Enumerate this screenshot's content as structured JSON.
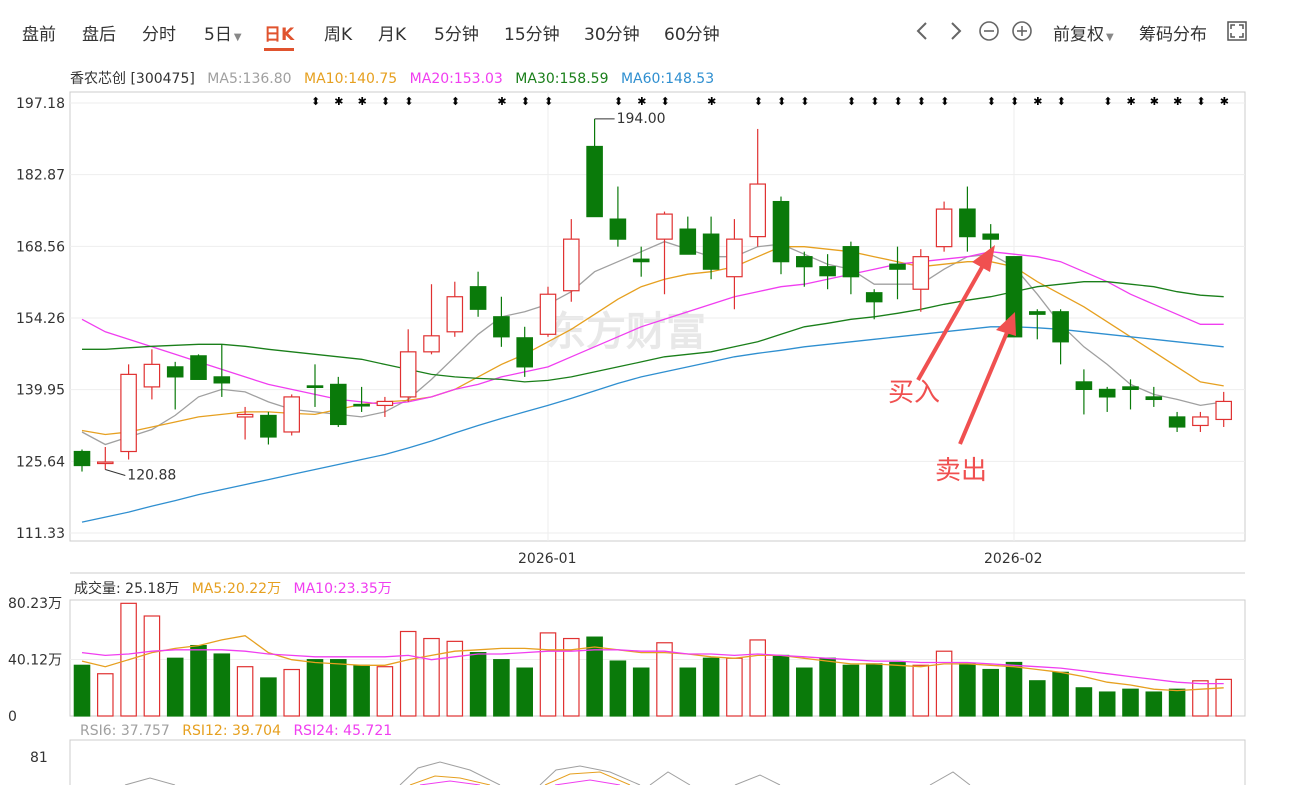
{
  "toolbar": {
    "tabs": [
      "盘前",
      "盘后",
      "分时",
      "5日",
      "日K",
      "周K",
      "月K",
      "5分钟",
      "15分钟",
      "30分钟",
      "60分钟"
    ],
    "active_tab": "日K",
    "prev_icon": "chevron-left-icon",
    "next_icon": "chevron-right-icon",
    "zoom_out_icon": "zoom-out-icon",
    "zoom_in_icon": "zoom-in-icon",
    "adjust_label": "前复权",
    "chip_label": "筹码分布",
    "fullscreen_icon": "fullscreen-icon"
  },
  "price_legend": {
    "stock": "香农芯创 [300475]",
    "ma5": "MA5:136.80",
    "ma10": "MA10:140.75",
    "ma20": "MA20:153.03",
    "ma30": "MA30:158.59",
    "ma60": "MA60:148.53"
  },
  "volume_legend": {
    "vol": "成交量: 25.18万",
    "ma5": "MA5:20.22万",
    "ma10": "MA10:23.35万"
  },
  "rsi_legend": {
    "rsi6": "RSI6: 37.757",
    "rsi12": "RSI12: 39.704",
    "rsi24": "RSI24: 45.721"
  },
  "colors": {
    "up": "#e03131",
    "down": "#0a7a0a",
    "ma5": "#a0a0a0",
    "ma10": "#e6a020",
    "ma20": "#f03ef0",
    "ma30": "#1a7f1a",
    "ma60": "#2f8fd0",
    "arrow": "#f05050"
  },
  "watermark": "东方财富",
  "chart_data": {
    "type": "candlestick",
    "price_axis": {
      "ticks": [
        "197.18",
        "182.87",
        "168.56",
        "154.26",
        "139.95",
        "125.64",
        "111.33"
      ],
      "ylim": [
        111.33,
        197.18
      ]
    },
    "x_ticks": [
      {
        "index": 20,
        "label": "2026-01"
      },
      {
        "index": 40,
        "label": "2026-02"
      }
    ],
    "candles": [
      {
        "o": 127.6,
        "h": 128.0,
        "l": 123.6,
        "c": 124.8
      },
      {
        "o": 125.5,
        "h": 128.5,
        "l": 124.0,
        "c": 125.5
      },
      {
        "o": 127.6,
        "h": 145.0,
        "l": 126.0,
        "c": 143.0
      },
      {
        "o": 140.5,
        "h": 148.0,
        "l": 138.0,
        "c": 145.0
      },
      {
        "o": 144.5,
        "h": 145.5,
        "l": 136.0,
        "c": 142.5
      },
      {
        "o": 146.7,
        "h": 147.0,
        "l": 142.0,
        "c": 142.0
      },
      {
        "o": 142.5,
        "h": 149.0,
        "l": 138.5,
        "c": 141.3
      },
      {
        "o": 134.5,
        "h": 136.5,
        "l": 130.0,
        "c": 135.0
      },
      {
        "o": 134.8,
        "h": 135.5,
        "l": 129.0,
        "c": 130.5
      },
      {
        "o": 131.5,
        "h": 139.0,
        "l": 130.8,
        "c": 138.5
      },
      {
        "o": 140.7,
        "h": 145.0,
        "l": 136.5,
        "c": 140.5
      },
      {
        "o": 141.0,
        "h": 142.5,
        "l": 132.5,
        "c": 133.0
      },
      {
        "o": 137.0,
        "h": 140.5,
        "l": 135.5,
        "c": 136.8
      },
      {
        "o": 136.8,
        "h": 138.5,
        "l": 134.5,
        "c": 137.6
      },
      {
        "o": 138.5,
        "h": 152.0,
        "l": 137.5,
        "c": 147.5
      },
      {
        "o": 147.5,
        "h": 161.0,
        "l": 147.0,
        "c": 150.7
      },
      {
        "o": 151.5,
        "h": 161.5,
        "l": 150.5,
        "c": 158.5
      },
      {
        "o": 160.5,
        "h": 163.5,
        "l": 154.5,
        "c": 156.0
      },
      {
        "o": 154.5,
        "h": 158.5,
        "l": 148.5,
        "c": 150.5
      },
      {
        "o": 150.3,
        "h": 152.5,
        "l": 142.5,
        "c": 144.5
      },
      {
        "o": 151.0,
        "h": 160.5,
        "l": 150.5,
        "c": 159.0
      },
      {
        "o": 159.7,
        "h": 174.0,
        "l": 157.5,
        "c": 170.0
      },
      {
        "o": 188.5,
        "h": 194.0,
        "l": 174.5,
        "c": 174.5
      },
      {
        "o": 174.0,
        "h": 180.5,
        "l": 168.5,
        "c": 170.0
      },
      {
        "o": 166.0,
        "h": 168.5,
        "l": 162.5,
        "c": 165.5
      },
      {
        "o": 170.0,
        "h": 175.5,
        "l": 159.0,
        "c": 175.0
      },
      {
        "o": 172.0,
        "h": 174.5,
        "l": 167.0,
        "c": 167.0
      },
      {
        "o": 171.0,
        "h": 174.5,
        "l": 162.0,
        "c": 164.0
      },
      {
        "o": 162.5,
        "h": 174.0,
        "l": 156.0,
        "c": 170.0
      },
      {
        "o": 170.5,
        "h": 192.0,
        "l": 168.5,
        "c": 181.0
      },
      {
        "o": 177.5,
        "h": 178.5,
        "l": 163.0,
        "c": 165.5
      },
      {
        "o": 166.5,
        "h": 167.5,
        "l": 160.5,
        "c": 164.5
      },
      {
        "o": 164.5,
        "h": 167.0,
        "l": 160.0,
        "c": 162.7
      },
      {
        "o": 168.5,
        "h": 169.5,
        "l": 159.0,
        "c": 162.5
      },
      {
        "o": 159.3,
        "h": 160.0,
        "l": 154.0,
        "c": 157.5
      },
      {
        "o": 165.0,
        "h": 168.5,
        "l": 158.0,
        "c": 164.0
      },
      {
        "o": 160.0,
        "h": 168.0,
        "l": 155.5,
        "c": 166.5
      },
      {
        "o": 168.5,
        "h": 177.5,
        "l": 167.5,
        "c": 176.0
      },
      {
        "o": 176.0,
        "h": 180.5,
        "l": 167.5,
        "c": 170.5
      },
      {
        "o": 171.0,
        "h": 173.0,
        "l": 165.0,
        "c": 170.0
      },
      {
        "o": 166.5,
        "h": 166.5,
        "l": 150.5,
        "c": 150.5
      },
      {
        "o": 155.5,
        "h": 156.0,
        "l": 150.0,
        "c": 155.0
      },
      {
        "o": 155.5,
        "h": 156.0,
        "l": 145.0,
        "c": 149.5
      },
      {
        "o": 141.5,
        "h": 144.0,
        "l": 135.0,
        "c": 140.0
      },
      {
        "o": 140.0,
        "h": 140.5,
        "l": 135.5,
        "c": 138.5
      },
      {
        "o": 140.5,
        "h": 142.0,
        "l": 136.0,
        "c": 140.0
      },
      {
        "o": 138.5,
        "h": 140.5,
        "l": 136.5,
        "c": 138.0
      },
      {
        "o": 134.5,
        "h": 135.5,
        "l": 131.5,
        "c": 132.5
      },
      {
        "o": 132.8,
        "h": 135.5,
        "l": 131.5,
        "c": 134.5
      },
      {
        "o": 134.0,
        "h": 139.5,
        "l": 132.5,
        "c": 137.6
      }
    ],
    "volume_axis": {
      "ticks": [
        "80.23万",
        "40.12万",
        "0"
      ],
      "ylim": [
        0,
        80.23
      ]
    },
    "volume": [
      36,
      30,
      80,
      71,
      41,
      50,
      44,
      35,
      27,
      33,
      40,
      40,
      36,
      35,
      60,
      55,
      53,
      45,
      40,
      34,
      59,
      55,
      56,
      39,
      34,
      52,
      34,
      41,
      41,
      54,
      43,
      34,
      41,
      36,
      37,
      38,
      36,
      46,
      37,
      33,
      38,
      25,
      31,
      20,
      17,
      19,
      17,
      19,
      25,
      26
    ],
    "series": [
      {
        "name": "MA5",
        "values": [
          131.5,
          129.0,
          130.5,
          132.0,
          134.8,
          138.5,
          140.0,
          139.5,
          137.5,
          136.0,
          135.5,
          135.0,
          134.5,
          135.5,
          138.0,
          142.0,
          146.5,
          151.0,
          154.5,
          155.5,
          157.0,
          159.5,
          163.5,
          165.5,
          167.5,
          169.5,
          168.0,
          166.5,
          166.5,
          168.5,
          169.0,
          167.0,
          165.0,
          164.0,
          161.0,
          161.0,
          161.0,
          164.0,
          166.5,
          167.0,
          164.5,
          159.0,
          153.0,
          148.5,
          145.0,
          141.0,
          139.0,
          138.0,
          136.8,
          137.5
        ]
      },
      {
        "name": "MA10",
        "values": [
          131.8,
          131.0,
          131.5,
          132.5,
          133.5,
          134.5,
          135.0,
          135.5,
          135.5,
          135.2,
          135.0,
          136.0,
          137.0,
          137.5,
          137.8,
          138.5,
          140.0,
          142.5,
          145.0,
          147.0,
          149.5,
          152.0,
          155.0,
          158.0,
          160.5,
          162.0,
          163.0,
          163.5,
          164.5,
          166.5,
          168.5,
          168.5,
          168.0,
          167.5,
          166.5,
          165.5,
          164.5,
          165.0,
          165.5,
          165.5,
          164.5,
          161.5,
          159.0,
          156.5,
          153.5,
          150.5,
          147.5,
          144.5,
          141.5,
          140.7
        ]
      },
      {
        "name": "MA20",
        "values": [
          154.0,
          151.5,
          150.0,
          148.5,
          147.0,
          145.5,
          144.0,
          142.5,
          141.0,
          140.0,
          139.0,
          138.0,
          137.5,
          137.0,
          137.5,
          138.5,
          140.0,
          141.0,
          142.5,
          143.5,
          144.5,
          146.5,
          148.5,
          150.5,
          152.5,
          154.0,
          155.5,
          157.0,
          158.5,
          159.5,
          160.5,
          161.0,
          162.0,
          163.0,
          164.0,
          165.0,
          165.5,
          166.0,
          166.5,
          167.5,
          167.0,
          166.5,
          165.5,
          163.5,
          161.5,
          159.0,
          157.0,
          155.0,
          153.0,
          153.0
        ]
      },
      {
        "name": "MA30",
        "values": [
          148.0,
          148.0,
          148.3,
          148.6,
          148.8,
          149.0,
          149.0,
          148.6,
          148.0,
          147.5,
          147.0,
          146.5,
          146.0,
          145.0,
          144.0,
          143.0,
          142.5,
          142.2,
          142.0,
          141.5,
          141.8,
          142.5,
          143.5,
          144.5,
          145.5,
          146.5,
          147.0,
          147.5,
          148.5,
          149.5,
          151.0,
          152.5,
          153.2,
          154.0,
          154.5,
          155.2,
          156.0,
          157.0,
          157.8,
          158.5,
          159.5,
          160.5,
          161.0,
          161.5,
          161.5,
          161.0,
          160.5,
          159.5,
          158.8,
          158.5
        ]
      },
      {
        "name": "MA60",
        "values": [
          113.5,
          114.5,
          115.5,
          116.7,
          117.8,
          119.0,
          120.0,
          121.0,
          122.0,
          123.0,
          124.0,
          125.0,
          126.0,
          127.0,
          128.3,
          129.7,
          131.3,
          132.8,
          134.2,
          135.5,
          136.8,
          138.2,
          139.7,
          141.2,
          142.5,
          143.5,
          144.5,
          145.5,
          146.5,
          147.2,
          147.8,
          148.5,
          149.0,
          149.5,
          150.0,
          150.5,
          151.0,
          151.5,
          152.0,
          152.5,
          152.5,
          152.3,
          152.0,
          151.5,
          151.0,
          150.5,
          150.0,
          149.5,
          149.0,
          148.5
        ]
      }
    ],
    "volume_series": [
      {
        "name": "MA5",
        "values": [
          39,
          35,
          40,
          45,
          48,
          50,
          54,
          57,
          45,
          40,
          38,
          37,
          36,
          36,
          40,
          43,
          46,
          47,
          48,
          48,
          47,
          47,
          49,
          47,
          45,
          45,
          44,
          42,
          41,
          43,
          43,
          41,
          39,
          37,
          37,
          36,
          35,
          37,
          37,
          36,
          35,
          33,
          31,
          28,
          24,
          22,
          19,
          18,
          19,
          20
        ]
      },
      {
        "name": "MA10",
        "values": [
          45,
          43,
          44,
          46,
          47,
          47,
          47,
          46,
          44,
          43,
          42,
          42,
          42,
          42,
          43,
          40,
          42,
          44,
          44,
          45,
          46,
          46,
          47,
          47,
          46,
          46,
          44,
          44,
          43,
          44,
          43,
          42,
          41,
          40,
          39,
          39,
          38,
          38,
          38,
          37,
          36,
          35,
          34,
          32,
          30,
          28,
          26,
          24,
          23,
          23
        ]
      }
    ],
    "price_markers": [
      {
        "index": 22,
        "label": "194.00"
      },
      {
        "index": 1,
        "label": "120.88"
      }
    ],
    "annotations": {
      "buy": "买入",
      "sell": "卖出"
    },
    "rsi_axis": {
      "tick": "81"
    }
  }
}
